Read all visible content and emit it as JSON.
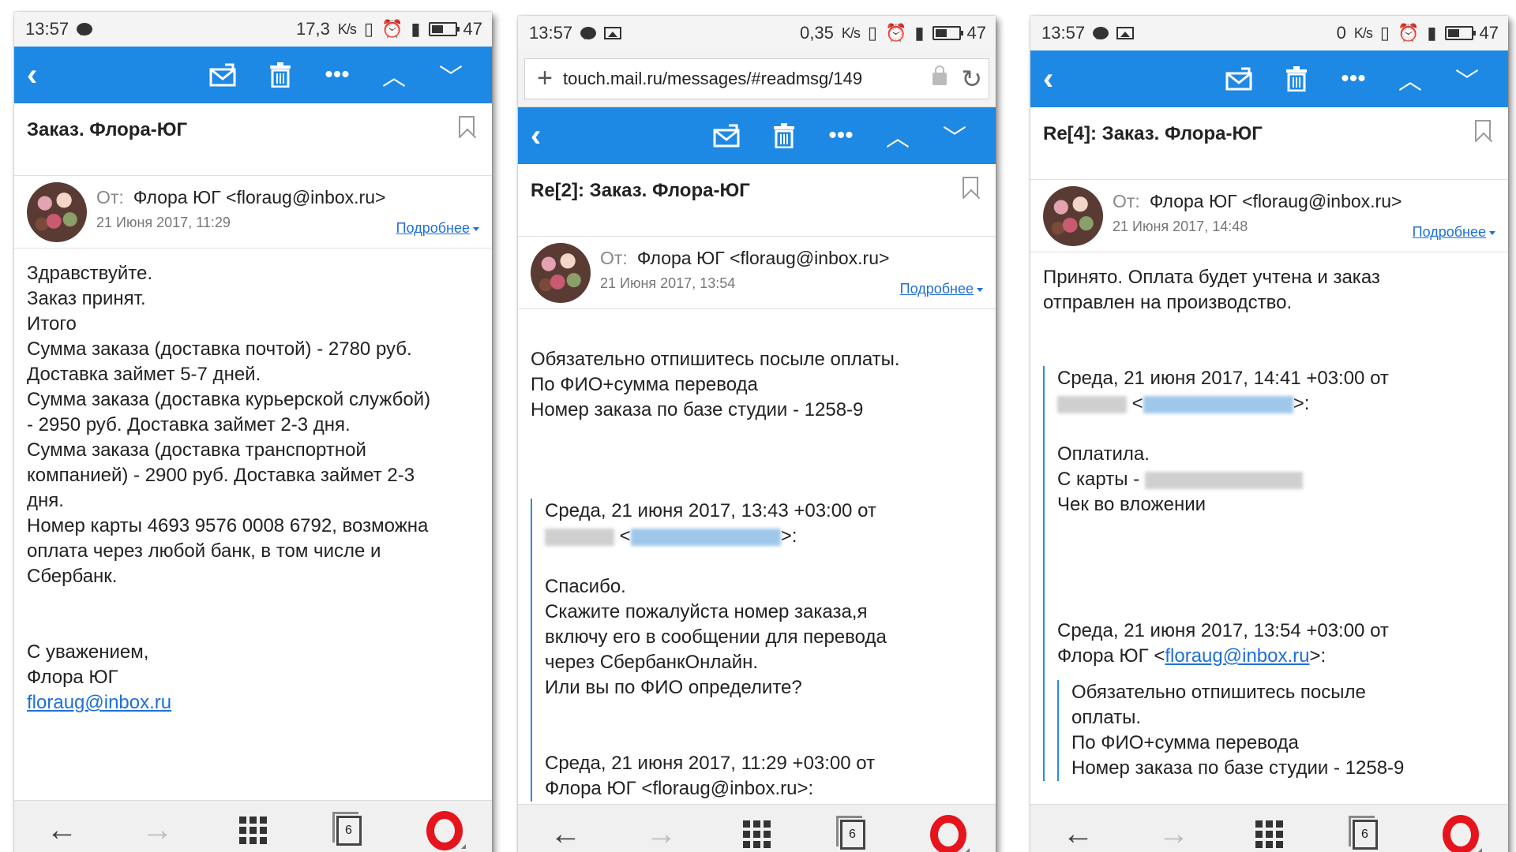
{
  "screens": [
    {
      "status": {
        "time": "13:57",
        "rate": "17,3",
        "rate_unit": "K/s",
        "battery": "47",
        "extra_icon": "image-icon"
      },
      "toolbar": {
        "actions": [
          "move-to-spam",
          "delete",
          "more",
          "previous",
          "next"
        ]
      },
      "subject": "Заказ. Флора-ЮГ",
      "sender": {
        "from_label": "От:",
        "from": "Флора ЮГ <floraug@inbox.ru>",
        "date": "21 Июня 2017, 11:29",
        "details_label": "Подробнее"
      },
      "body": {
        "lines": [
          "Здравствуйте.",
          "Заказ принят.",
          "Итого",
          "Сумма заказа (доставка почтой) - 2780 руб.",
          " Доставка займет 5-7 дней.",
          "Сумма заказа (доставка курьерской службой)",
          "- 2950 руб.  Доставка займет 2-3 дня.",
          "Сумма заказа (доставка транспортной",
          "компанией) - 2900 руб.  Доставка займет 2-3",
          "дня.",
          "Номер карты 4693 9576 0008 6792, возможна",
          "оплата через любой банк, в том числе и",
          "Сбербанк."
        ],
        "signature": [
          "С уважением,",
          "Флора ЮГ"
        ],
        "signature_link": "floraug@inbox.ru"
      }
    },
    {
      "status": {
        "time": "13:57",
        "rate": "0,35",
        "rate_unit": "K/s",
        "battery": "47"
      },
      "url": "touch.mail.ru/messages/#readmsg/149",
      "subject": "Re[2]: Заказ. Флора-ЮГ",
      "sender": {
        "from_label": "От:",
        "from": "Флора ЮГ <floraug@inbox.ru>",
        "date": "21 Июня 2017, 13:54",
        "details_label": "Подробнее"
      },
      "body": {
        "lines": [
          "Обязательно отпишитесь посыле оплаты.",
          "По ФИО+сумма перевода",
          "Номер заказа по базе студии - 1258-9"
        ],
        "quote1_header": "Среда, 21 июня 2017, 13:43 +03:00 от",
        "quote1_lines": [
          "Спасибо.",
          "Скажите пожалуйста номер заказа,я",
          "включу его в сообщении для перевода",
          "через СбербанкОнлайн.",
          "Или вы по ФИО определите?"
        ],
        "quote2_header": "Среда, 21 июня 2017, 11:29 +03:00 от",
        "quote2_from": "Флора ЮГ <floraug@inbox.ru>:"
      }
    },
    {
      "status": {
        "time": "13:57",
        "rate": "0",
        "rate_unit": "K/s",
        "battery": "47"
      },
      "subject": "Re[4]: Заказ. Флора-ЮГ",
      "sender": {
        "from_label": "От:",
        "from": "Флора ЮГ <floraug@inbox.ru>",
        "date": "21 Июня 2017, 14:48",
        "details_label": "Подробнее"
      },
      "body": {
        "lines": [
          "Принято. Оплата будет учтена и заказ",
          "отправлен на производство."
        ],
        "quote1_header": "Среда, 21 июня 2017, 14:41 +03:00 от",
        "quote1_lines": [
          "Оплатила."
        ],
        "quote1_card": "С карты -",
        "quote1_last": "Чек во вложении",
        "quote2_header": "Среда, 21 июня 2017, 13:54 +03:00 от",
        "quote2_from_prefix": "Флора ЮГ <",
        "quote2_from_link": "floraug@inbox.ru",
        "quote2_from_suffix": ">:",
        "quote2_lines": [
          "Обязательно отпишитесь посыле",
          "оплаты.",
          "По ФИО+сумма перевода",
          "Номер заказа по базе студии - 1258-9"
        ]
      }
    }
  ],
  "nav": {
    "tabs_count": "6"
  },
  "colors": {
    "toolbar": "#1e88e5",
    "link": "#1e6fd9",
    "opera": "#e5141d"
  }
}
